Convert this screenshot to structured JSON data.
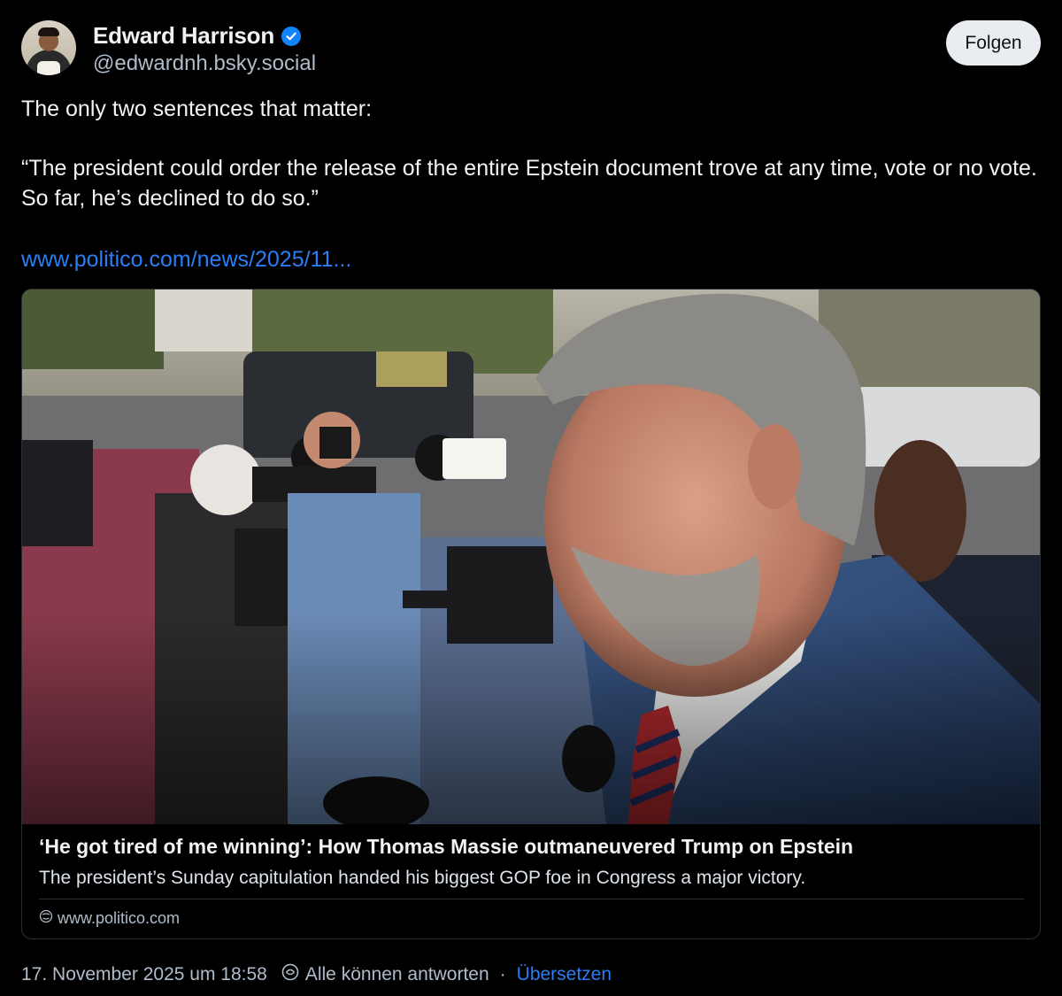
{
  "author": {
    "name": "Edward Harrison",
    "handle": "@edwardnh.bsky.social",
    "verified": true
  },
  "actions": {
    "follow_label": "Folgen"
  },
  "post": {
    "line1": "The only two sentences that matter:",
    "quote": "“The president could order the release of the entire Epstein document trove at any time, vote or no vote. So far, he’s declined to do so.”",
    "link_text": "www.politico.com/news/2025/11..."
  },
  "card": {
    "title": "‘He got tired of me winning’: How Thomas Massie outmaneuvered Trump on Epstein",
    "description": "The president’s Sunday capitulation handed his biggest GOP foe in Congress a major victory.",
    "domain": "www.politico.com"
  },
  "footer": {
    "timestamp": "17. November 2025 um 18:58",
    "reply_setting": "Alle können antworten",
    "separator": "·",
    "translate_label": "Übersetzen"
  },
  "colors": {
    "background": "#000000",
    "link": "#2b7df4",
    "verified": "#1083fe",
    "muted": "#aebbc9"
  },
  "icons": {
    "verified": "verified-badge-icon",
    "globe": "globe-icon",
    "reply_setting": "reply-setting-icon"
  }
}
